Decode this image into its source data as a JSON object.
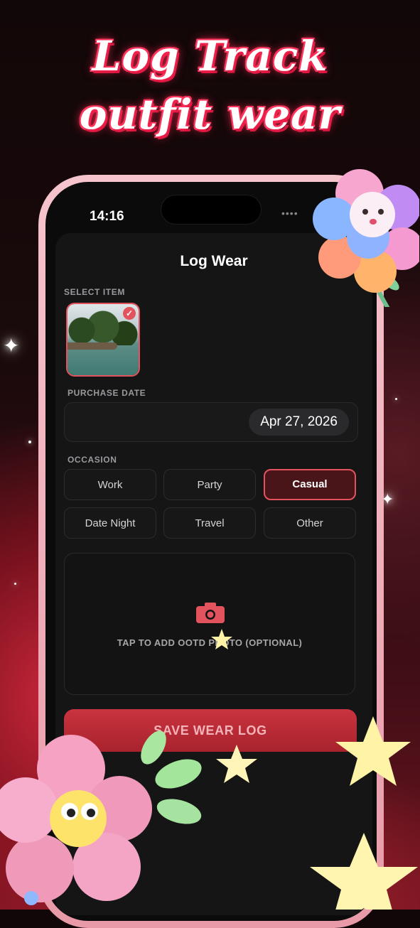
{
  "promo": {
    "headline_line1": "Log Track",
    "headline_line2": "outfit wear"
  },
  "status_bar": {
    "time": "14:16",
    "signal_dots": "••••"
  },
  "sheet": {
    "title": "Log Wear",
    "select_item_label": "SELECT ITEM",
    "purchase_date_label": "PURCHASE DATE",
    "purchase_date_value": "Apr 27, 2026",
    "occasion_label": "OCCASION",
    "occasions": [
      "Work",
      "Party",
      "Casual",
      "Date Night",
      "Travel",
      "Other"
    ],
    "selected_occasion": "Casual",
    "photo_prompt": "TAP TO ADD OOTD PHOTO (OPTIONAL)",
    "save_button": "SAVE WEAR LOG"
  },
  "colors": {
    "accent": "#e2535d",
    "background": "#0b0b0c",
    "headline_glow": "#ff2d55"
  },
  "icons": {
    "selected_check": "✓",
    "camera": "camera-icon"
  }
}
